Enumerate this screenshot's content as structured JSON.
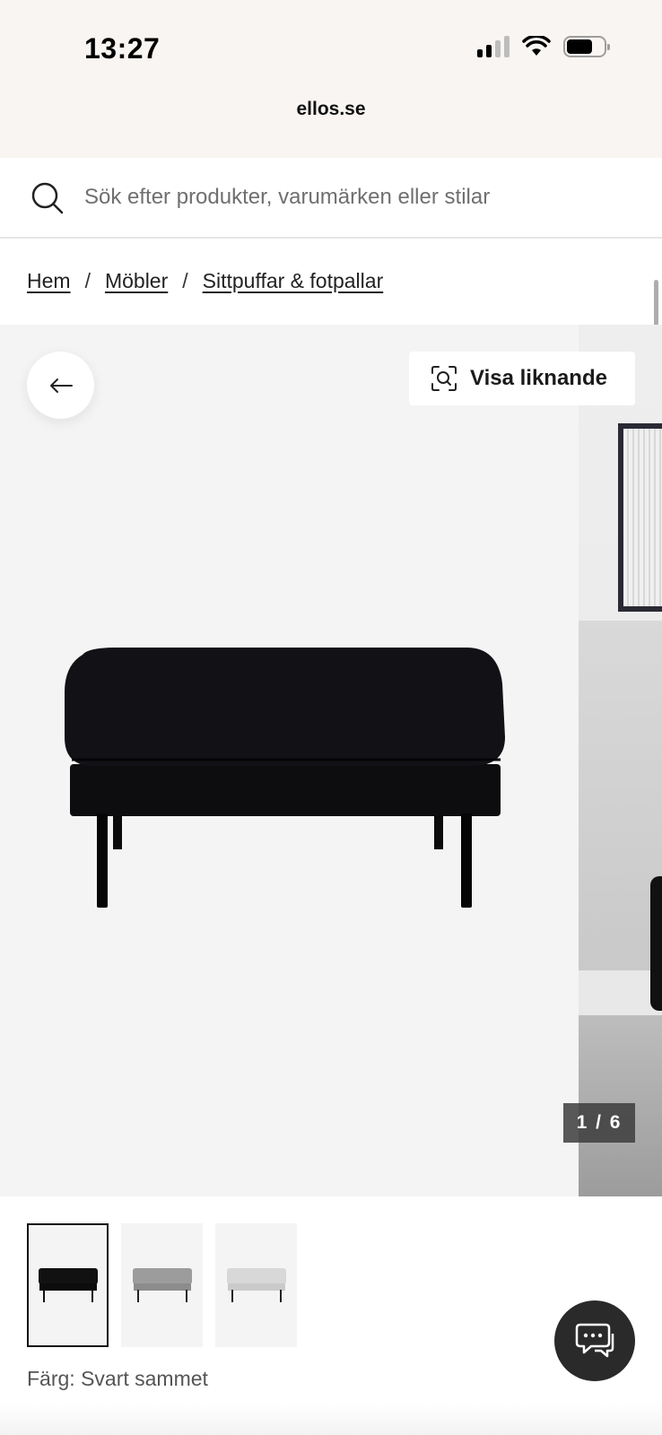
{
  "status_bar": {
    "time": "13:27"
  },
  "browser": {
    "url": "ellos.se"
  },
  "search": {
    "placeholder": "Sök efter produkter, varumärken eller stilar",
    "value": ""
  },
  "breadcrumb": {
    "items": [
      "Hem",
      "Möbler",
      "Sittpuffar & fotpallar"
    ],
    "separator": "/"
  },
  "gallery": {
    "similar_button_label": "Visa liknande",
    "counter": "1 / 6",
    "current_index": 1,
    "total": 6
  },
  "thumbnails": {
    "colors": [
      "#111111",
      "#9a9a9a",
      "#d6d6d6"
    ],
    "selected_index": 0
  },
  "color_label": "Färg: Svart sammet",
  "colors": {
    "status_bg": "#f8f5f2",
    "gallery_bg": "#f4f4f4",
    "chat_bg": "#2a2a2a"
  }
}
